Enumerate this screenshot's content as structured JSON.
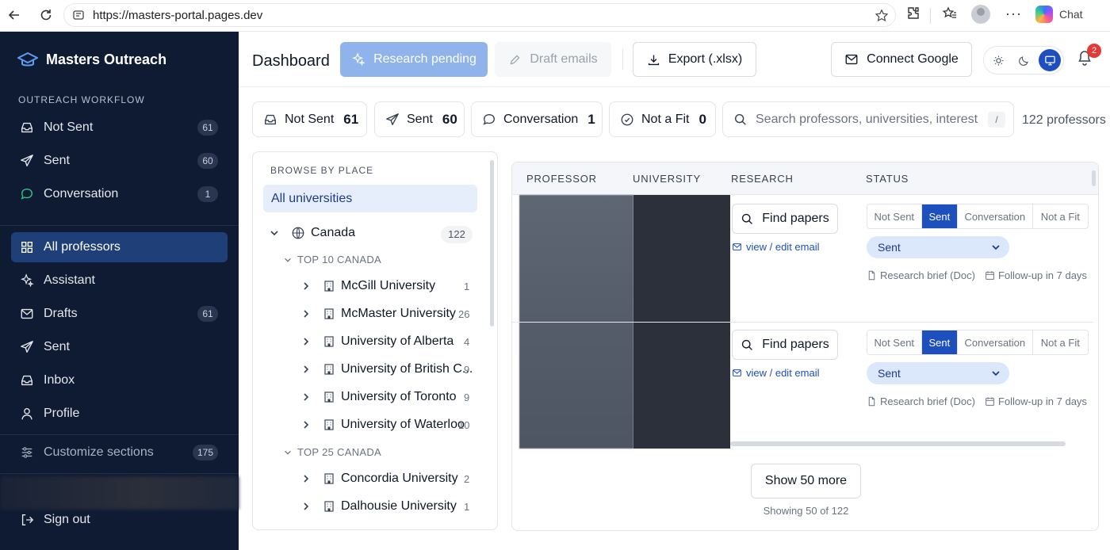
{
  "browser": {
    "url": "https://masters-portal.pages.dev",
    "chat_label": "Chat",
    "more_label": "···"
  },
  "sidebar": {
    "brand": "Masters Outreach",
    "section_label": "OUTREACH WORKFLOW",
    "workflow": [
      {
        "label": "Not Sent",
        "count": "61",
        "icon": "inbox-icon"
      },
      {
        "label": "Sent",
        "count": "60",
        "icon": "send-icon"
      },
      {
        "label": "Conversation",
        "count": "1",
        "icon": "chat-bubble-icon"
      }
    ],
    "nav": [
      {
        "label": "All professors",
        "icon": "grid-icon",
        "active": true
      },
      {
        "label": "Assistant",
        "icon": "sparkle-icon"
      },
      {
        "label": "Drafts",
        "icon": "mail-icon",
        "count": "61"
      },
      {
        "label": "Sent",
        "icon": "send-icon"
      },
      {
        "label": "Inbox",
        "icon": "inbox-icon"
      },
      {
        "label": "Profile",
        "icon": "user-icon"
      }
    ],
    "customize": {
      "label": "Customize sections",
      "count": "175"
    },
    "sign_out": "Sign out"
  },
  "header": {
    "title": "Dashboard",
    "research_btn": "Research pending",
    "draft_btn": "Draft emails",
    "export_btn": "Export (.xlsx)",
    "google_btn": "Connect Google",
    "notifications": "2"
  },
  "filters": [
    {
      "label": "Not Sent",
      "count": "61",
      "icon": "inbox-icon"
    },
    {
      "label": "Sent",
      "count": "60",
      "icon": "send-icon"
    },
    {
      "label": "Conversation",
      "count": "1",
      "icon": "chat-bubble-icon"
    },
    {
      "label": "Not a Fit",
      "count": "0",
      "icon": "circle-slash-icon"
    }
  ],
  "search": {
    "placeholder": "Search professors, universities, interests",
    "shortcut": "/",
    "result_count": "122 professors"
  },
  "browse": {
    "title": "BROWSE BY PLACE",
    "all_label": "All universities",
    "country": {
      "label": "Canada",
      "count": "122"
    },
    "groups": [
      {
        "label": "TOP 10 CANADA",
        "items": [
          {
            "label": "McGill University",
            "count": "1"
          },
          {
            "label": "McMaster University",
            "count": "26"
          },
          {
            "label": "University of Alberta",
            "count": "4"
          },
          {
            "label": "University of British C...",
            "count": "9"
          },
          {
            "label": "University of Toronto",
            "count": "9"
          },
          {
            "label": "University of Waterloo",
            "count": "10"
          }
        ]
      },
      {
        "label": "TOP 25 CANADA",
        "items": [
          {
            "label": "Concordia University",
            "count": "2"
          },
          {
            "label": "Dalhousie University",
            "count": "1"
          }
        ]
      }
    ]
  },
  "table": {
    "headers": [
      "PROFESSOR",
      "UNIVERSITY",
      "RESEARCH",
      "STATUS"
    ],
    "rows": [
      {
        "find": "Find papers",
        "edit": "view / edit email",
        "status_options": [
          "Not Sent",
          "Sent",
          "Conversation",
          "Not a Fit"
        ],
        "selected": "Sent",
        "brief": "Research brief (Doc)",
        "followup": "Follow-up in 7 days"
      },
      {
        "find": "Find papers",
        "edit": "view / edit email",
        "status_options": [
          "Not Sent",
          "Sent",
          "Conversation",
          "Not a Fit"
        ],
        "selected": "Sent",
        "brief": "Research brief (Doc)",
        "followup": "Follow-up in 7 days"
      }
    ],
    "show_more": "Show 50 more",
    "showing": "Showing 50 of 122"
  }
}
